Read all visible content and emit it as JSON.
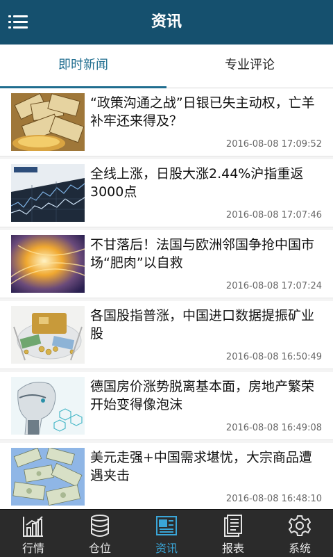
{
  "header": {
    "title": "资讯",
    "menu_icon": "menu-icon"
  },
  "tabs": [
    {
      "label": "即时新闻",
      "active": true
    },
    {
      "label": "专业评论",
      "active": false
    }
  ],
  "news": [
    {
      "headline": "“政策沟通之战”日银已失主动权，亡羊补牢还来得及？",
      "time": "2016-08-08 17:09:52",
      "thumb": "money-stack-image"
    },
    {
      "headline": "全线上涨，日股大涨2.44%沪指重返3000点",
      "time": "2016-08-08 17:07:46",
      "thumb": "stock-chart-image"
    },
    {
      "headline": "不甘落后！法国与欧洲邻国争抢中国市场“肥肉”以自救",
      "time": "2016-08-08 17:07:24",
      "thumb": "golden-light-image"
    },
    {
      "headline": "各国股指普涨，中国进口数据提振矿业股",
      "time": "2016-08-08 16:50:49",
      "thumb": "coins-plate-image"
    },
    {
      "headline": "德国房价涨势脱离基本面，房地产繁荣开始变得像泡沫",
      "time": "2016-08-08 16:49:08",
      "thumb": "robot-head-image"
    },
    {
      "headline": "美元走强+中国需求堪忧，大宗商品遭遇夹击",
      "time": "2016-08-08 16:48:10",
      "thumb": "dollar-bills-image"
    }
  ],
  "bottom_nav": [
    {
      "label": "行情",
      "icon": "bar-chart-icon",
      "active": false
    },
    {
      "label": "仓位",
      "icon": "database-icon",
      "active": false
    },
    {
      "label": "资讯",
      "icon": "newspaper-icon",
      "active": true
    },
    {
      "label": "报表",
      "icon": "report-icon",
      "active": false
    },
    {
      "label": "系统",
      "icon": "gear-icon",
      "active": false
    }
  ],
  "colors": {
    "header_bg": "#15506e",
    "accent": "#1f6d8f",
    "nav_bg": "#2b2b2b",
    "nav_active": "#3aa6d8"
  }
}
